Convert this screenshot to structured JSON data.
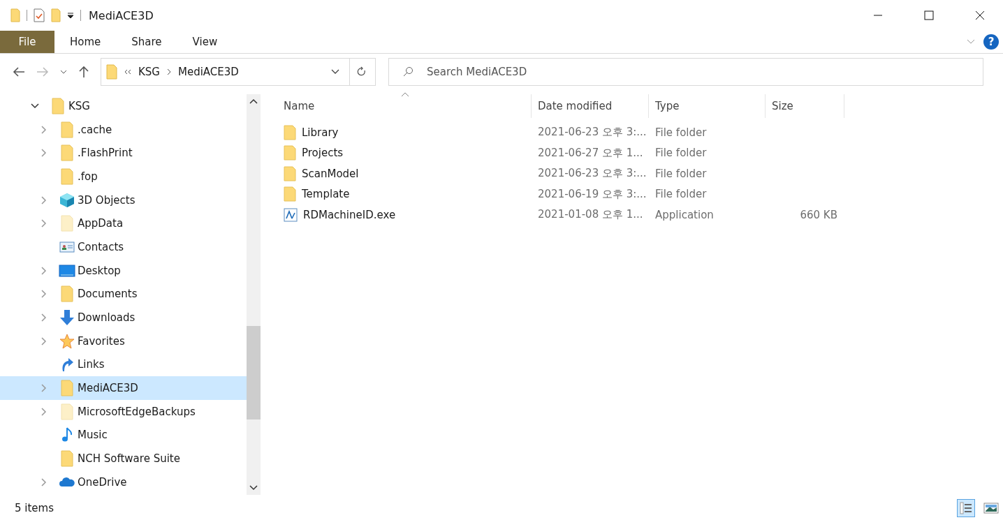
{
  "window": {
    "title": "MediACE3D"
  },
  "ribbon": {
    "tabs": [
      {
        "label": "File",
        "selected": true
      },
      {
        "label": "Home",
        "selected": false
      },
      {
        "label": "Share",
        "selected": false
      },
      {
        "label": "View",
        "selected": false
      }
    ],
    "help": "?"
  },
  "address": {
    "path": [
      "KSG",
      "MediACE3D"
    ]
  },
  "search": {
    "placeholder": "Search MediACE3D"
  },
  "tree": [
    {
      "label": "KSG",
      "kind": "folder",
      "expanded": true,
      "selected": false,
      "children": [
        {
          "label": ".cache",
          "kind": "folder",
          "expanded": false,
          "selected": false
        },
        {
          "label": ".FlashPrint",
          "kind": "folder",
          "expanded": false,
          "selected": false
        },
        {
          "label": ".fop",
          "kind": "folder",
          "selected": false
        },
        {
          "label": "3D Objects",
          "kind": "cube",
          "expanded": false,
          "selected": false
        },
        {
          "label": "AppData",
          "kind": "hidden-folder",
          "expanded": false,
          "selected": false
        },
        {
          "label": "Contacts",
          "kind": "contacts",
          "selected": false
        },
        {
          "label": "Desktop",
          "kind": "desktop",
          "expanded": false,
          "selected": false
        },
        {
          "label": "Documents",
          "kind": "folder",
          "expanded": false,
          "selected": false
        },
        {
          "label": "Downloads",
          "kind": "download",
          "expanded": false,
          "selected": false
        },
        {
          "label": "Favorites",
          "kind": "star",
          "expanded": false,
          "selected": false
        },
        {
          "label": "Links",
          "kind": "link",
          "selected": false
        },
        {
          "label": "MediACE3D",
          "kind": "folder",
          "expanded": false,
          "selected": true
        },
        {
          "label": "MicrosoftEdgeBackups",
          "kind": "hidden-folder",
          "expanded": false,
          "selected": false
        },
        {
          "label": "Music",
          "kind": "music",
          "selected": false
        },
        {
          "label": "NCH Software Suite",
          "kind": "folder",
          "selected": false
        },
        {
          "label": "OneDrive",
          "kind": "cloud",
          "expanded": false,
          "selected": false
        }
      ]
    }
  ],
  "table": {
    "columns": [
      "Name",
      "Date modified",
      "Type",
      "Size"
    ],
    "rows": [
      {
        "kind": "folder",
        "name": "Library",
        "date": "2021-06-23 오후 3:...",
        "type": "File folder",
        "size": ""
      },
      {
        "kind": "folder",
        "name": "Projects",
        "date": "2021-06-27 오후 1...",
        "type": "File folder",
        "size": ""
      },
      {
        "kind": "folder",
        "name": "ScanModel",
        "date": "2021-06-23 오후 3:...",
        "type": "File folder",
        "size": ""
      },
      {
        "kind": "folder",
        "name": "Template",
        "date": "2021-06-19 오후 3:...",
        "type": "File folder",
        "size": ""
      },
      {
        "kind": "app",
        "name": "RDMachineID.exe",
        "date": "2021-01-08 오후 1...",
        "type": "Application",
        "size": "660 KB"
      }
    ]
  },
  "status_bar": {
    "count": "5 items"
  }
}
